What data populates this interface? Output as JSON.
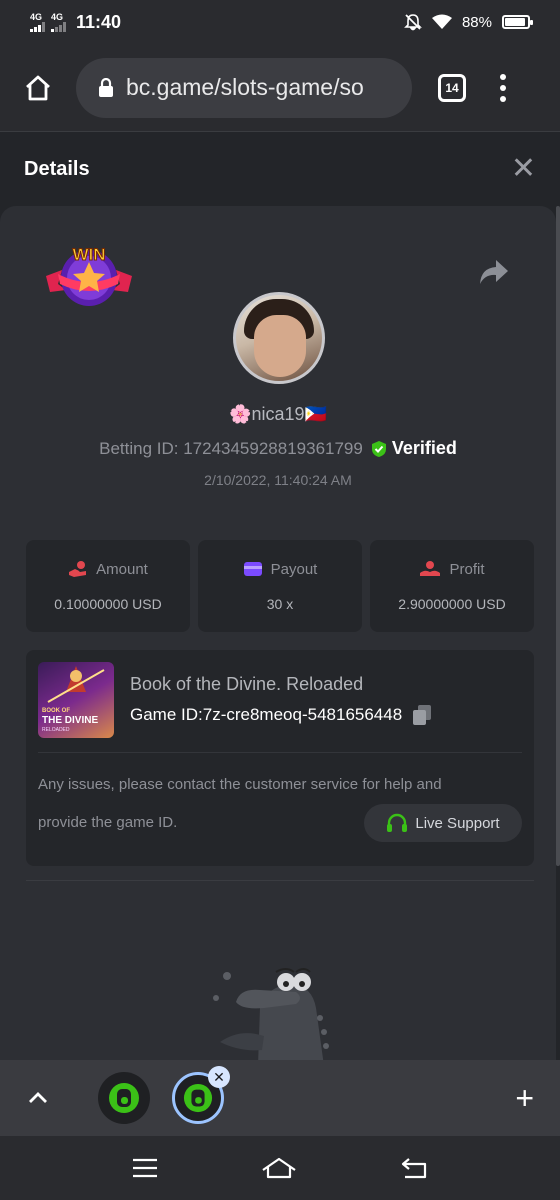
{
  "status_bar": {
    "sim1": "4G",
    "sim2": "4G",
    "time": "11:40",
    "battery": "88%"
  },
  "browser": {
    "url": "bc.game/slots-game/so",
    "tab_count": "14"
  },
  "details": {
    "title": "Details",
    "username": "🌸nica19🇵🇭",
    "betting_id_label": "Betting ID: 1724345928819361799",
    "verified_label": "Verified",
    "timestamp": "2/10/2022, 11:40:24 AM",
    "stats": [
      {
        "label": "Amount",
        "value": "0.10000000 USD",
        "icon": "hand-coin-icon"
      },
      {
        "label": "Payout",
        "value": "30 x",
        "icon": "wallet-icon"
      },
      {
        "label": "Profit",
        "value": "2.90000000 USD",
        "icon": "profit-icon"
      }
    ],
    "game": {
      "name": "Book of the Divine. Reloaded",
      "id_label": "Game ID:",
      "id_value": "7z-cre8meoq-5481656448",
      "thumb_line1": "BOOK OF",
      "thumb_line2": "THE DIVINE",
      "thumb_line3": "RELOADED"
    },
    "issue_line1": "Any issues, please contact the customer service for help and",
    "issue_line2": "provide the game ID.",
    "live_support_label": "Live Support",
    "win_badge_text": "WIN"
  },
  "colors": {
    "accent_green": "#3bc117",
    "amount_red": "#e2474f",
    "payout_purple": "#7b4bff"
  }
}
